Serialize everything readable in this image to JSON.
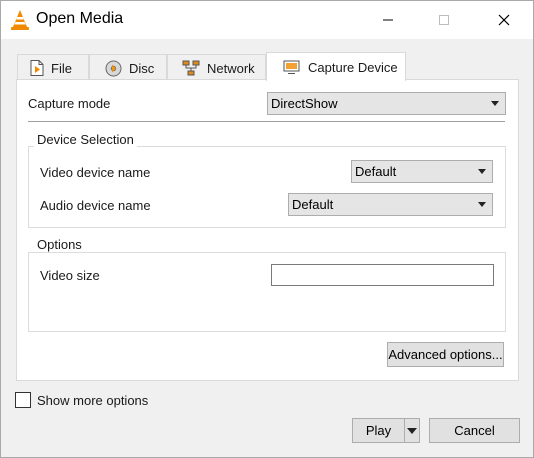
{
  "window": {
    "title": "Open Media"
  },
  "tabs": [
    {
      "label": "File",
      "icon": "file-icon"
    },
    {
      "label": "Disc",
      "icon": "disc-icon"
    },
    {
      "label": "Network",
      "icon": "network-icon"
    },
    {
      "label": "Capture Device",
      "icon": "capture-device-icon",
      "active": true
    }
  ],
  "capture": {
    "mode_label": "Capture mode",
    "mode_value": "DirectShow"
  },
  "device_selection": {
    "title": "Device Selection",
    "video_label": "Video device name",
    "video_value": "Default",
    "audio_label": "Audio device name",
    "audio_value": "Default"
  },
  "options": {
    "title": "Options",
    "video_size_label": "Video size",
    "video_size_value": ""
  },
  "advanced_label": "Advanced options...",
  "show_more_label": "Show more options",
  "play_label": "Play",
  "cancel_label": "Cancel",
  "colors": {
    "vlc_orange": "#f08a00",
    "panel_bg": "#ffffff",
    "window_bg": "#f0f0f0"
  }
}
